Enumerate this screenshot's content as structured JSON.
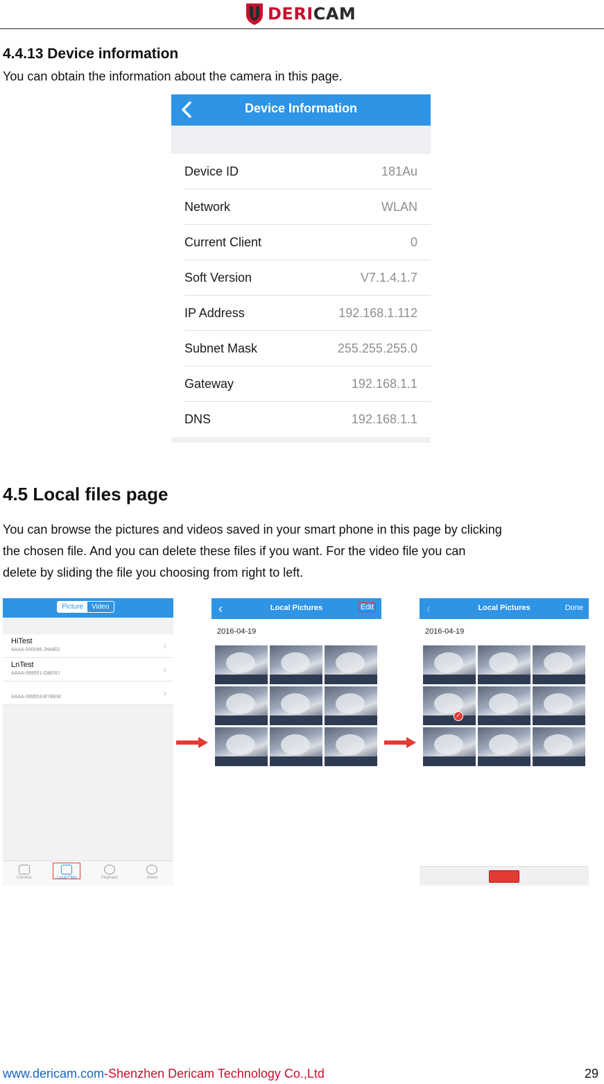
{
  "header": {
    "logo_part1": "DERI",
    "logo_part2": "CAM"
  },
  "section_4413": {
    "title": "4.4.13 Device information",
    "text": "You can obtain the information about the camera in this page."
  },
  "device_info": {
    "title": "Device Information",
    "rows": [
      {
        "label": "Device ID",
        "value": "181Au"
      },
      {
        "label": "Network",
        "value": "WLAN"
      },
      {
        "label": "Current Client",
        "value": "0"
      },
      {
        "label": "Soft Version",
        "value": "V7.1.4.1.7"
      },
      {
        "label": "IP Address",
        "value": "192.168.1.112"
      },
      {
        "label": "Subnet Mask",
        "value": "255.255.255.0"
      },
      {
        "label": "Gateway",
        "value": "192.168.1.1"
      },
      {
        "label": "DNS",
        "value": "192.168.1.1"
      }
    ]
  },
  "section_45": {
    "title": "4.5 Local files page",
    "line1": "You can browse the pictures and videos saved in your smart phone in this page by clicking",
    "line2": "the chosen file. And you can delete these files if you want. For the video file you can",
    "line3": "delete by sliding the file you choosing from right to left."
  },
  "local_files": {
    "segment": [
      "Picture",
      "Video"
    ],
    "items": [
      {
        "name": "HiTest",
        "uid": "AAAA-000066-JNMED"
      },
      {
        "name": "LnTest",
        "uid": "AAAA-099551-GBERJ"
      },
      {
        "name": "",
        "uid": "AAAA-099553-BYBEW"
      }
    ],
    "tabs": [
      "Camera",
      "Local Files",
      "Playback",
      "About"
    ]
  },
  "local_pictures_edit": {
    "title": "Local Pictures",
    "button": "Edit",
    "date": "2016-04-19"
  },
  "local_pictures_done": {
    "title": "Local Pictures",
    "button": "Done",
    "date": "2016-04-19"
  },
  "colors": {
    "accent": "#2e94e6",
    "brand_red": "#c8102e",
    "highlight": "#e53935"
  },
  "footer": {
    "site": "www.dericam.com",
    "company": "-Shenzhen Dericam Technology Co.,Ltd",
    "page": "29"
  }
}
